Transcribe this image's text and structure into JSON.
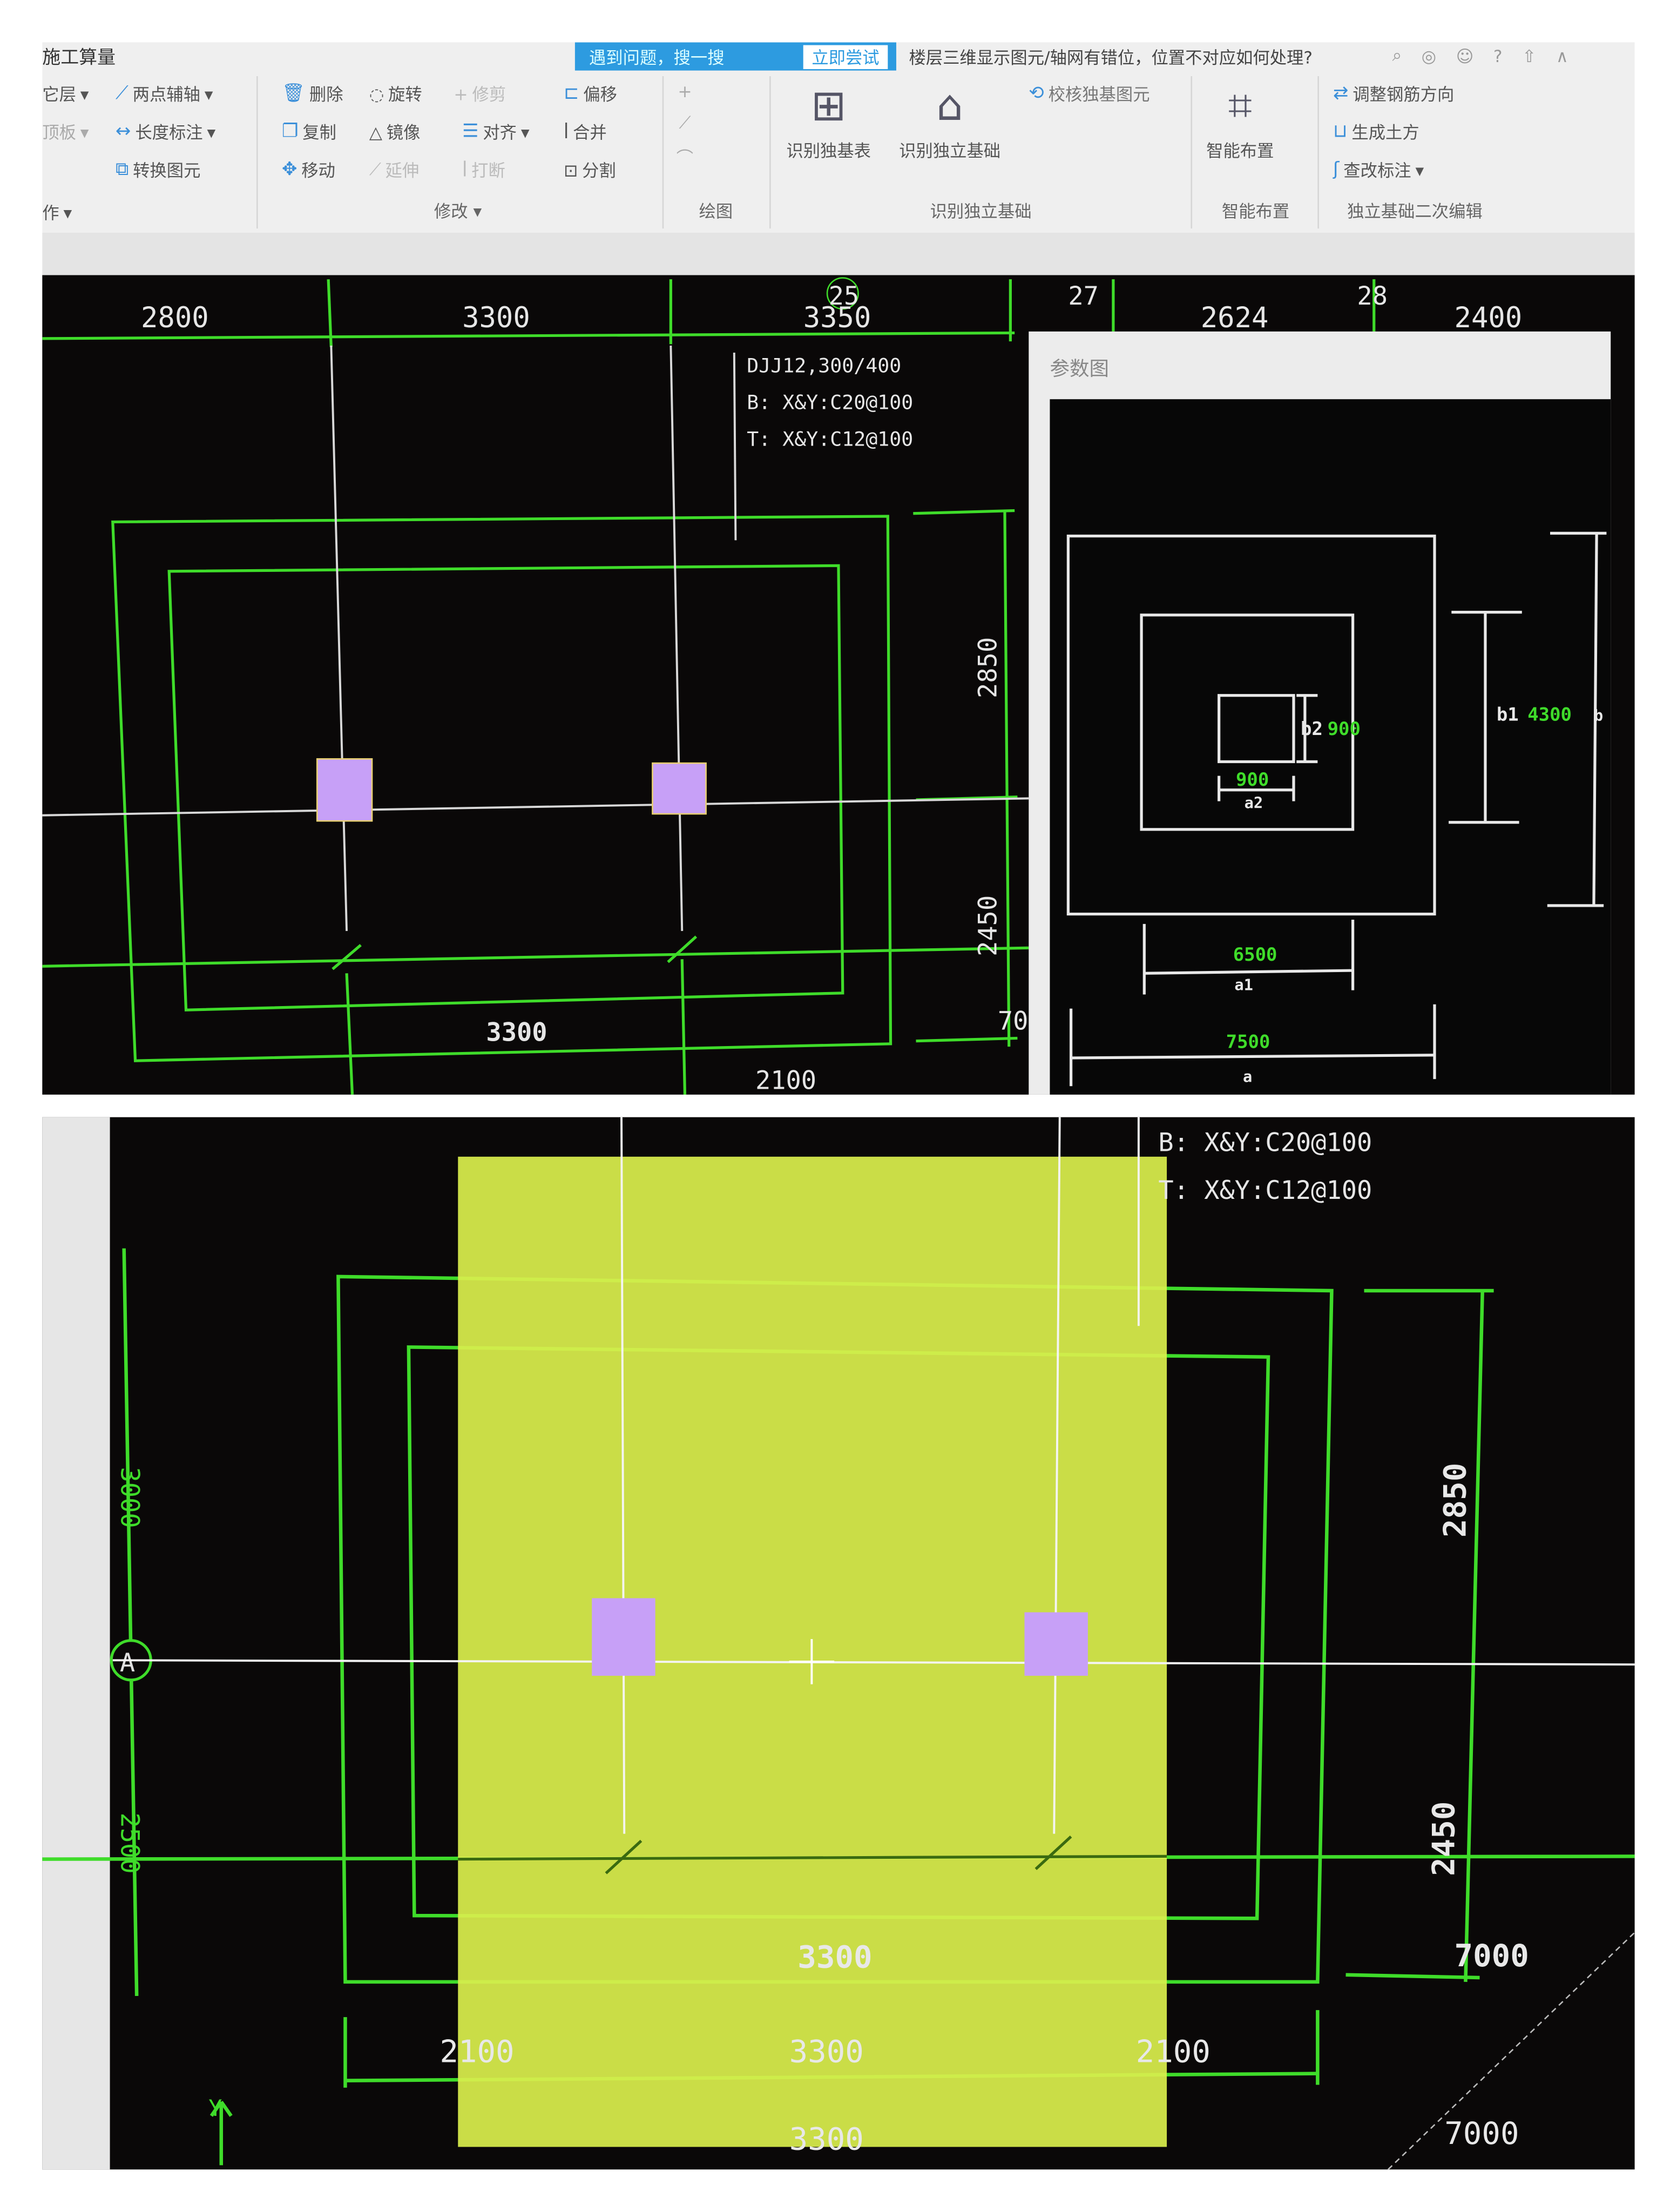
{
  "toolbar": {
    "title": "施工算量",
    "banner_text": "遇到问题，搜一搜",
    "banner_button": "立即尝试",
    "question": "楼层三维显示图元/轴网有错位，位置不对应如何处理?",
    "left_items": [
      "它层",
      "顶板",
      "作"
    ],
    "col1": [
      "两点辅轴",
      "长度标注",
      "转换图元"
    ],
    "modify": [
      "删除",
      "旋转",
      "修剪",
      "偏移",
      "复制",
      "镜像",
      "对齐",
      "合并",
      "移动",
      "延伸",
      "打断",
      "分割"
    ],
    "big_buttons": [
      "识别独基表",
      "识别独立基础",
      "智能布置"
    ],
    "check_button": "校核独基图元",
    "edit_items": [
      "调整钢筋方向",
      "生成土方",
      "查改标注"
    ],
    "groups": [
      "修改",
      "绘图",
      "识别独立基础",
      "智能布置",
      "独立基础二次编辑"
    ],
    "icons": [
      "search-icon",
      "user-icon",
      "chat-icon",
      "help-icon",
      "upload-icon",
      "collapse-icon"
    ]
  },
  "colors": {
    "cad_bg": "#0a0808",
    "grid_green": "#3fdc2a",
    "column_purple": "#c7a0f7",
    "highlight_yellow": "#d9ee4c",
    "toolbar_blue": "#2d9be0"
  },
  "panel1": {
    "top_dims": [
      "2800",
      "3300",
      "3350",
      "2624",
      "2400"
    ],
    "axis_labels": [
      "25",
      "27",
      "28"
    ],
    "annotation": [
      "DJJ12,300/400",
      "B: X&Y:C20@100",
      "T: X&Y:C12@100"
    ],
    "right_dims": [
      "2850",
      "2450",
      "70"
    ],
    "bottom_dims": [
      "3300",
      "2100"
    ],
    "param_window": {
      "title": "参数图",
      "labels": {
        "b2": "b2",
        "b2_val": "900",
        "a2_val": "900",
        "a2": "a2",
        "b1": "b1",
        "b1_val": "4300",
        "b": "b",
        "a1_val": "6500",
        "a1": "a1",
        "a_val": "7500",
        "a": "a"
      }
    }
  },
  "panel2": {
    "annotation": [
      "B: X&Y:C20@100",
      "T: X&Y:C12@100"
    ],
    "axis_label": "A",
    "right_dims": [
      "2850",
      "2450",
      "7000",
      "7000"
    ],
    "inner_dim": "3300",
    "bottom_dims": [
      "2100",
      "3300",
      "2100",
      "3300"
    ],
    "side_dims": [
      "3000",
      "2500"
    ],
    "y_axis": "Y"
  }
}
